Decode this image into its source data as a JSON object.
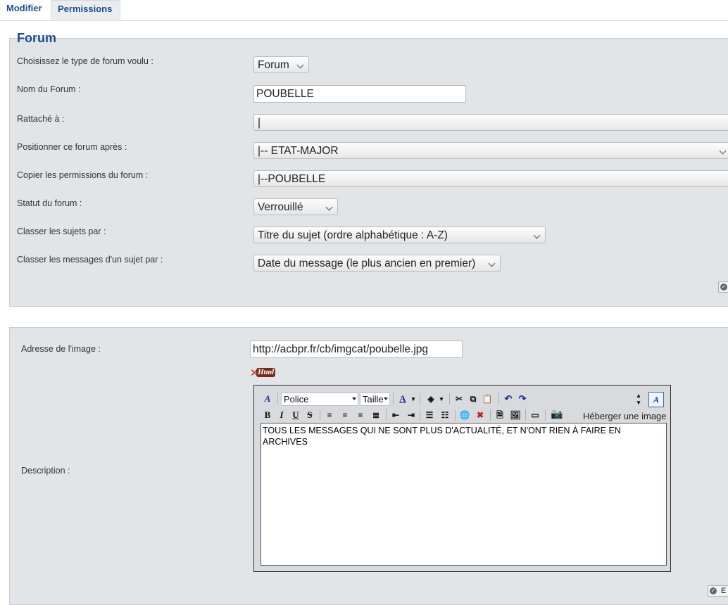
{
  "tabs": [
    {
      "label": "Modifier",
      "active": true
    },
    {
      "label": "Permissions",
      "active": false
    }
  ],
  "forum_section": {
    "legend": "Forum",
    "fields": {
      "type": {
        "label": "Choisissez le type de forum voulu :",
        "value": "Forum"
      },
      "name": {
        "label": "Nom du Forum :",
        "value": "POUBELLE"
      },
      "parent": {
        "label": "Rattaché à :",
        "value": "|"
      },
      "position": {
        "label": "Positionner ce forum après :",
        "value": "|-- ETAT-MAJOR"
      },
      "copy_permissions": {
        "label": "Copier les permissions du forum :",
        "value": "|--POUBELLE"
      },
      "status": {
        "label": "Statut du forum :",
        "value": "Verrouillé"
      },
      "sort_topics": {
        "label": "Classer les sujets par :",
        "value": "Titre du sujet (ordre alphabétique : A-Z)"
      },
      "sort_messages": {
        "label": "Classer les messages d'un sujet par :",
        "value": "Date du message (le plus ancien en premier)"
      }
    }
  },
  "image_section": {
    "image_label": "Adresse de l'image :",
    "image_value": "http://acbpr.fr/cb/imgcat/poubelle.jpg",
    "html_toggle": "Html",
    "description_label": "Description :",
    "editor": {
      "font_select": "Police",
      "size_select": "Taille",
      "upload_label": "Héberger une image",
      "content": "TOUS LES MESSAGES QUI NE SONT PLUS D'ACTUALITÉ, ET N'ONT RIEN À FAIRE EN ARCHIVES"
    },
    "submit_partial": "E"
  },
  "colors": {
    "accent": "#1c4d8c",
    "panel_bg": "#e2e5e8"
  }
}
